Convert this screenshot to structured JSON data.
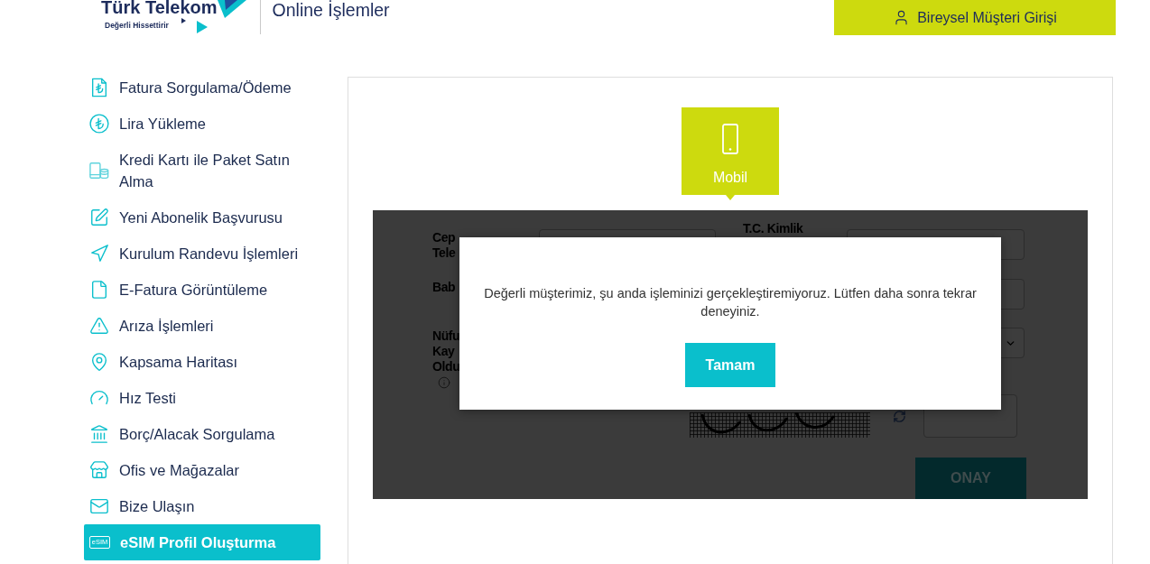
{
  "header": {
    "logo": {
      "name": "Türk Telekom",
      "tagline": "Değerli Hissettirir"
    },
    "title": "Online İşlemler",
    "login_button": "Bireysel Müşteri Girişi"
  },
  "sidebar": {
    "items": [
      {
        "label": "Fatura Sorgulama/Ödeme",
        "selected": false
      },
      {
        "label": "Lira Yükleme",
        "selected": false
      },
      {
        "label": "Kredi Kartı ile Paket Satın Alma",
        "selected": false
      },
      {
        "label": "Yeni Abonelik Başvurusu",
        "selected": false
      },
      {
        "label": "Kurulum Randevu İşlemleri",
        "selected": false
      },
      {
        "label": "E-Fatura Görüntüleme",
        "selected": false
      },
      {
        "label": "Arıza İşlemleri",
        "selected": false
      },
      {
        "label": "Kapsama Haritası",
        "selected": false
      },
      {
        "label": "Hız Testi",
        "selected": false
      },
      {
        "label": "Borç/Alacak Sorgulama",
        "selected": false
      },
      {
        "label": "Ofis ve Mağazalar",
        "selected": false
      },
      {
        "label": "Bize Ulaşın",
        "selected": false
      },
      {
        "label": "eSIM Profil Oluşturma",
        "selected": true,
        "icon_label": "eSIM"
      }
    ]
  },
  "tabs": [
    {
      "label": "Mobil",
      "selected": true
    }
  ],
  "form": {
    "rows": [
      {
        "fields": [
          {
            "kind": "input",
            "label": "Cep Tele"
          },
          {
            "kind": "input",
            "label": "T.C. Kimlik"
          }
        ]
      },
      {
        "fields": [
          {
            "kind": "label",
            "label": "Bab"
          },
          {
            "kind": "input"
          }
        ]
      },
      {
        "fields": [
          {
            "kind": "label",
            "label": "Nüfu Kay Oldu",
            "info": true
          },
          {
            "kind": "select"
          }
        ]
      }
    ],
    "submit_button": "ONAY"
  },
  "dialog": {
    "message": "Değerli müşterimiz, şu anda işleminizi gerçekleştiremiyoruz. Lütfen daha sonra tekrar deneyiniz.",
    "button": "Tamam"
  }
}
